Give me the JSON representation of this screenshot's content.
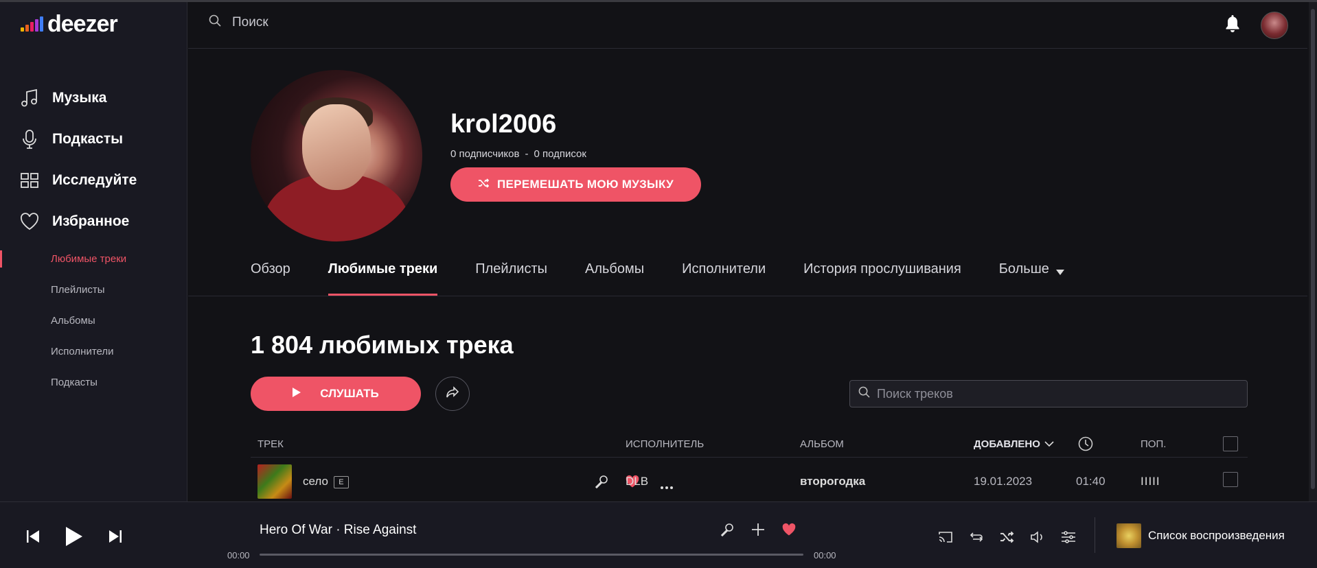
{
  "app": {
    "logo_text": "deezer",
    "logo_bar_colors": [
      "#f0b400",
      "#e8611e",
      "#e81e63",
      "#a338d6",
      "#3f7ef7"
    ]
  },
  "sidebar": {
    "main_items": [
      {
        "label": "Музыка",
        "icon": "music-note-icon"
      },
      {
        "label": "Подкасты",
        "icon": "microphone-icon"
      },
      {
        "label": "Исследуйте",
        "icon": "grid-icon"
      },
      {
        "label": "Избранное",
        "icon": "heart-icon"
      }
    ],
    "sub_items": [
      {
        "label": "Любимые треки",
        "active": true
      },
      {
        "label": "Плейлисты",
        "active": false
      },
      {
        "label": "Альбомы",
        "active": false
      },
      {
        "label": "Исполнители",
        "active": false
      },
      {
        "label": "Подкасты",
        "active": false
      }
    ]
  },
  "topbar": {
    "search_placeholder": "Поиск"
  },
  "profile": {
    "name": "krol2006",
    "followers": "0 подписчиков",
    "separator": "-",
    "following": "0 подписок",
    "shuffle_label": "ПЕРЕМЕШАТЬ МОЮ МУЗЫКУ"
  },
  "tabs": [
    {
      "label": "Обзор",
      "active": false
    },
    {
      "label": "Любимые треки",
      "active": true
    },
    {
      "label": "Плейлисты",
      "active": false
    },
    {
      "label": "Альбомы",
      "active": false
    },
    {
      "label": "Исполнители",
      "active": false
    },
    {
      "label": "История прослушивания",
      "active": false
    },
    {
      "label": "Больше",
      "active": false
    }
  ],
  "favorites": {
    "title": "1 804 любимых трека",
    "play_label": "СЛУШАТЬ",
    "search_placeholder": "Поиск треков"
  },
  "table": {
    "headers": {
      "track": "ТРЕК",
      "artist": "ИСПОЛНИТЕЛЬ",
      "album": "АЛЬБОМ",
      "added": "ДОБАВЛЕНО",
      "popularity": "ПОП."
    },
    "rows": [
      {
        "title": "село",
        "explicit": "E",
        "artist": "DLB",
        "album": "второгодка",
        "added": "19.01.2023",
        "duration": "01:40",
        "popularity": "IIIII"
      }
    ]
  },
  "player": {
    "now_playing": "Hero Of War · Rise Against",
    "time_current": "00:00",
    "time_total": "00:00",
    "progress": 0,
    "queue_label": "Список воспроизведения"
  },
  "colors": {
    "accent": "#ef5466",
    "background": "#121216",
    "sidebar": "#191922"
  }
}
